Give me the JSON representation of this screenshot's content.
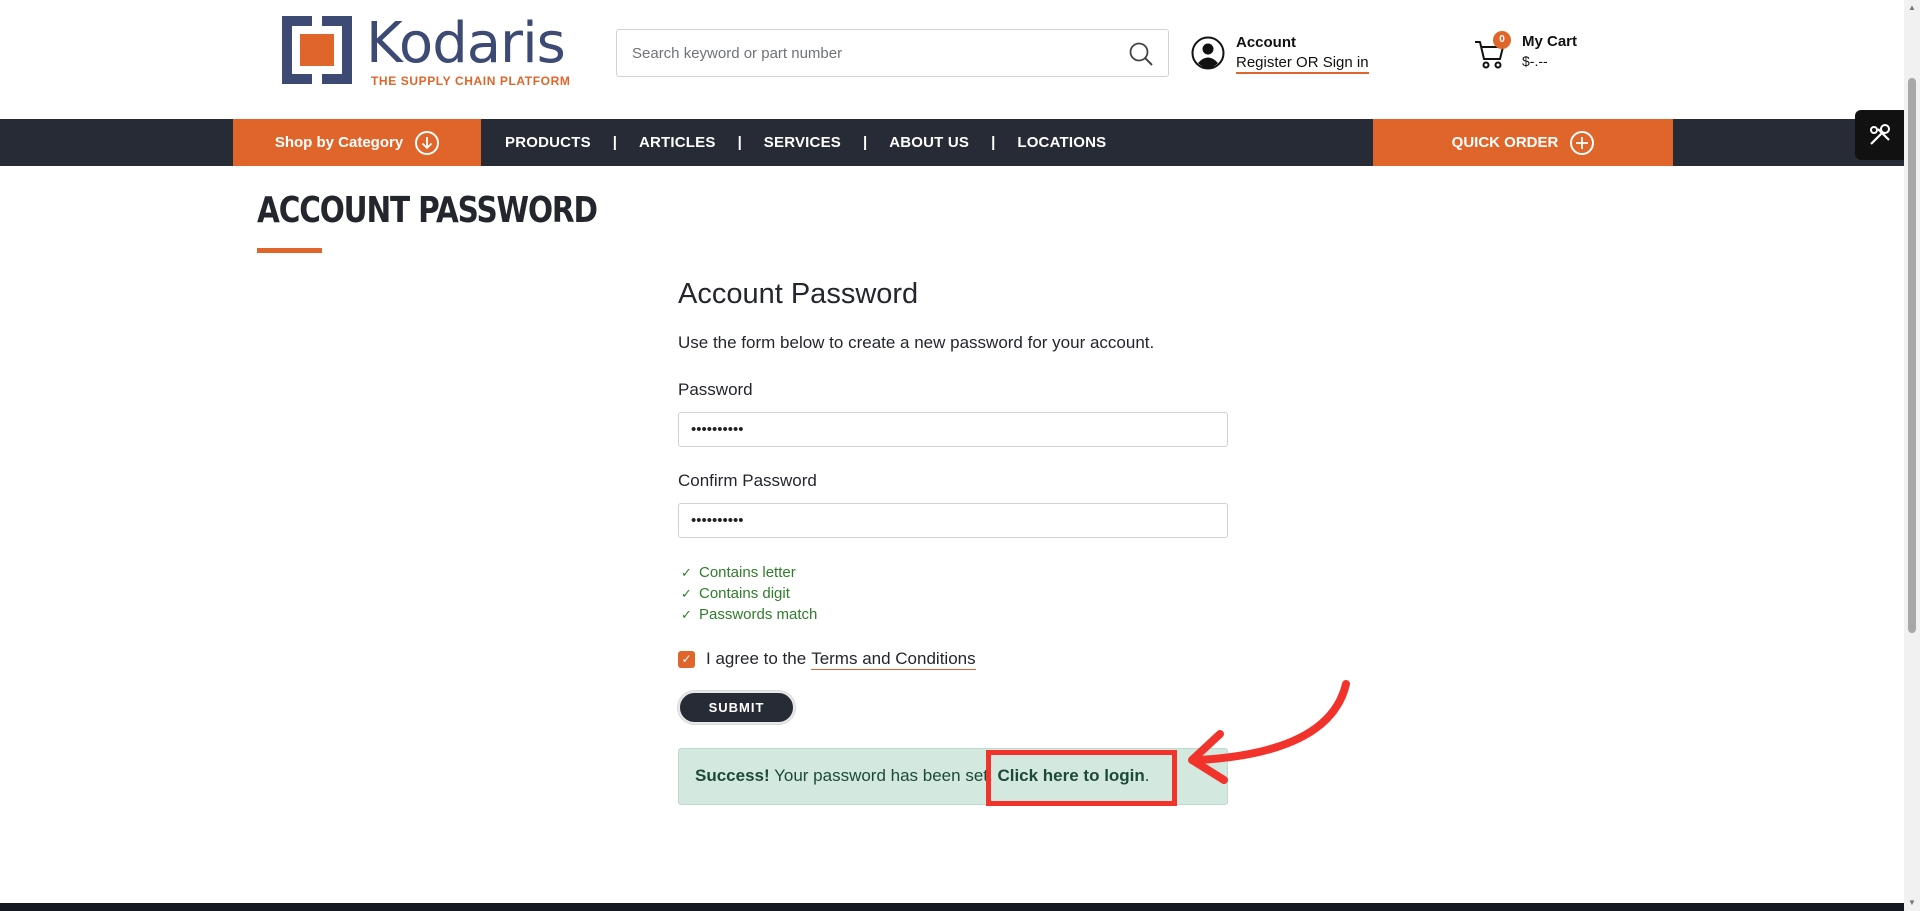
{
  "header": {
    "logo": {
      "name": "Kodaris",
      "tagline": "THE SUPPLY CHAIN PLATFORM"
    },
    "search": {
      "placeholder": "Search keyword or part number",
      "icon": "search-icon"
    },
    "account": {
      "title": "Account",
      "link": "Register OR Sign in"
    },
    "cart": {
      "title": "My Cart",
      "count": "0",
      "total": "$-.--"
    }
  },
  "nav": {
    "shop_by_category": "Shop by Category",
    "links": [
      "PRODUCTS",
      "ARTICLES",
      "SERVICES",
      "ABOUT US",
      "LOCATIONS"
    ],
    "quick_order": "QUICK ORDER"
  },
  "page": {
    "title": "ACCOUNT PASSWORD"
  },
  "form": {
    "heading": "Account Password",
    "intro": "Use the form below to create a new password for your account.",
    "password_label": "Password",
    "password_value": "••••••••••",
    "confirm_label": "Confirm Password",
    "confirm_value": "••••••••••",
    "rules": [
      "Contains letter",
      "Contains digit",
      "Passwords match"
    ],
    "agree_text": "I agree to the",
    "terms_link": "Terms and Conditions",
    "agree_checked": true,
    "submit": "SUBMIT"
  },
  "success": {
    "strong": "Success!",
    "message": " Your password has been set. ",
    "link": "Click here to login",
    "end": "."
  },
  "colors": {
    "accent": "#e0652a",
    "nav_bg": "#262b35",
    "success_bg": "#d3e8df",
    "rule_ok": "#2f7d2b",
    "annotation": "#f2332b"
  }
}
